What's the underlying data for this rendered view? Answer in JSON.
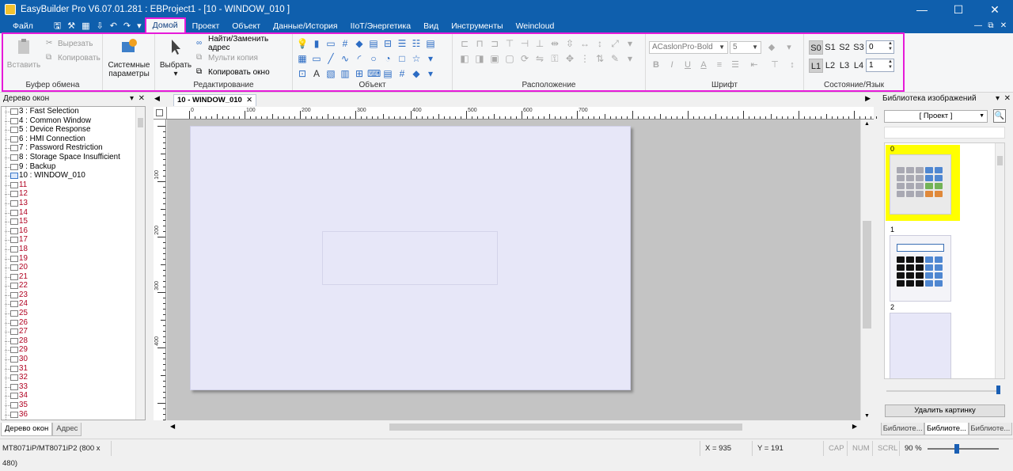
{
  "window": {
    "title": "EasyBuilder Pro V6.07.01.281 : EBProject1 - [10 - WINDOW_010 ]",
    "minimize": "—",
    "maximize": "☐",
    "close": "✕"
  },
  "menubar": {
    "file": "Файл",
    "tabs": [
      "Домой",
      "Проект",
      "Объект",
      "Данные/История",
      "IIoT/Энергетика",
      "Вид",
      "Инструменты",
      "Weincloud"
    ],
    "active_tab": "Домой",
    "mdi": [
      "—",
      "⧉",
      "✕"
    ]
  },
  "ribbon": {
    "clipboard": {
      "label": "Буфер обмена",
      "paste": "Вставить",
      "cut": "Вырезать",
      "copy": "Копировать"
    },
    "system": {
      "label": "Системные\nпараметры",
      "line1": "Системные",
      "line2": "параметры"
    },
    "edit": {
      "label": "Редактирование",
      "select": "Выбрать",
      "find_replace": "Найти/Заменить адрес",
      "multi_copy": "Мульти копия",
      "copy_window": "Копировать окно"
    },
    "object": {
      "label": "Объект"
    },
    "arrange": {
      "label": "Расположение"
    },
    "font": {
      "label": "Шрифт",
      "font_name": "ACaslonPro-Bold",
      "font_size": "5"
    },
    "state_lang": {
      "label": "Состояние/Язык",
      "states": [
        "S0",
        "S1",
        "S2",
        "S3"
      ],
      "state_value": "0",
      "langs": [
        "L1",
        "L2",
        "L3",
        "L4"
      ],
      "lang_value": "1"
    }
  },
  "tree_panel": {
    "title": "Дерево окон",
    "items": [
      {
        "label": "3 : Fast Selection",
        "named": true
      },
      {
        "label": "4 : Common Window",
        "named": true
      },
      {
        "label": "5 : Device Response",
        "named": true
      },
      {
        "label": "6 : HMI Connection",
        "named": true
      },
      {
        "label": "7 : Password Restriction",
        "named": true
      },
      {
        "label": "8 : Storage Space Insufficient",
        "named": true
      },
      {
        "label": "9 : Backup",
        "named": true
      },
      {
        "label": "10 : WINDOW_010",
        "named": true,
        "current": true
      },
      {
        "label": "11"
      },
      {
        "label": "12"
      },
      {
        "label": "13"
      },
      {
        "label": "14"
      },
      {
        "label": "15"
      },
      {
        "label": "16"
      },
      {
        "label": "17"
      },
      {
        "label": "18"
      },
      {
        "label": "19"
      },
      {
        "label": "20"
      },
      {
        "label": "21"
      },
      {
        "label": "22"
      },
      {
        "label": "23"
      },
      {
        "label": "24"
      },
      {
        "label": "25"
      },
      {
        "label": "26"
      },
      {
        "label": "27"
      },
      {
        "label": "28"
      },
      {
        "label": "29"
      },
      {
        "label": "30"
      },
      {
        "label": "31"
      },
      {
        "label": "32"
      },
      {
        "label": "33"
      },
      {
        "label": "34"
      },
      {
        "label": "35"
      },
      {
        "label": "36"
      }
    ],
    "tabs": [
      "Дерево окон",
      "Адрес"
    ]
  },
  "document": {
    "tab": "10 - WINDOW_010",
    "ruler_h": [
      "0",
      "100",
      "200",
      "300",
      "400",
      "500",
      "600",
      "700"
    ],
    "ruler_v": [
      "100",
      "200",
      "300",
      "400"
    ]
  },
  "library_panel": {
    "title": "Библиотека изображений",
    "scope": "[ Проект ]",
    "items": [
      "0",
      "1",
      "2"
    ],
    "delete": "Удалить картинку",
    "tabs": [
      "Библиоте...",
      "Библиоте...",
      "Библиоте..."
    ]
  },
  "statusbar": {
    "model": "MT8071iP/MT8071iP2 (800 x 480)",
    "x": "X = 935",
    "y": "Y = 191",
    "caps": "CAP",
    "num": "NUM",
    "scrl": "SCRL",
    "zoom": "90 %"
  },
  "colors": {
    "titlebar": "#0f5fad",
    "highlight": "#e61ad9",
    "selected_image": "#ffff00",
    "canvas": "#e7e7f8"
  }
}
